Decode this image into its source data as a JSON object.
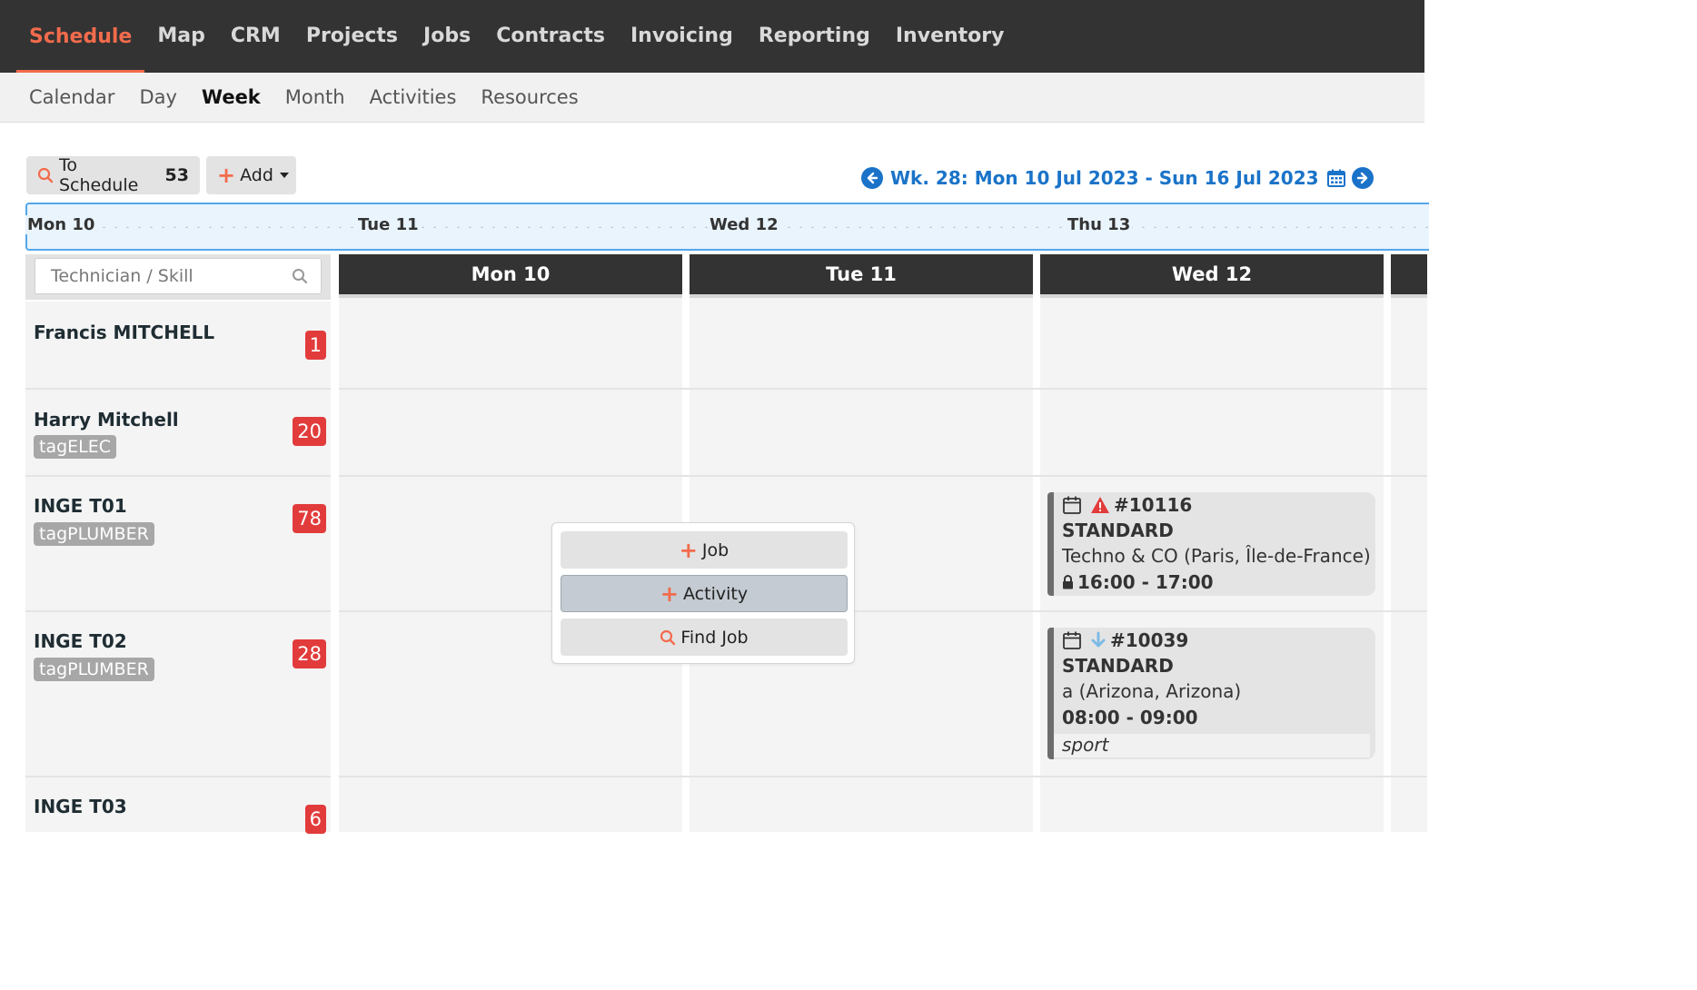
{
  "topnav": {
    "items": [
      "Schedule",
      "Map",
      "CRM",
      "Projects",
      "Jobs",
      "Contracts",
      "Invoicing",
      "Reporting",
      "Inventory"
    ],
    "active": "Schedule"
  },
  "subnav": {
    "items": [
      "Calendar",
      "Day",
      "Week",
      "Month",
      "Activities",
      "Resources"
    ],
    "active": "Week"
  },
  "toolbar": {
    "to_schedule_label": "To Schedule",
    "to_schedule_count": "53",
    "add_label": "Add"
  },
  "week": {
    "range_label": "Wk. 28: Mon 10 Jul 2023 - Sun 16 Jul 2023"
  },
  "timeline": {
    "labels": [
      "Mon 10",
      "Tue 11",
      "Wed 12",
      "Thu 13"
    ]
  },
  "search": {
    "placeholder": "Technician / Skill"
  },
  "days": [
    "Mon 10",
    "Tue 11",
    "Wed 12"
  ],
  "resources": [
    {
      "name": "Francis MITCHELL",
      "tag": "",
      "count": "1"
    },
    {
      "name": "Harry Mitchell",
      "tag": "tagELEC",
      "count": "20"
    },
    {
      "name": "INGE T01",
      "tag": "tagPLUMBER",
      "count": "78"
    },
    {
      "name": "INGE T02",
      "tag": "tagPLUMBER",
      "count": "28"
    },
    {
      "name": "INGE T03",
      "tag": "",
      "count": "6"
    }
  ],
  "popup": {
    "job_label": "Job",
    "activity_label": "Activity",
    "find_job_label": "Find Job"
  },
  "jobs": [
    {
      "number": "#10116",
      "type": "STANDARD",
      "customer": "Techno & CO (Paris, Île-de-France)",
      "time": "16:00 - 17:00",
      "note": ""
    },
    {
      "number": "#10039",
      "type": "STANDARD",
      "customer": "a (Arizona, Arizona)",
      "time": "08:00 - 09:00",
      "note": "sport"
    }
  ],
  "colors": {
    "accent": "#f26b4c",
    "link_blue": "#1a73c8",
    "badge_red": "#e23b3b",
    "nav_bg": "#333333"
  }
}
